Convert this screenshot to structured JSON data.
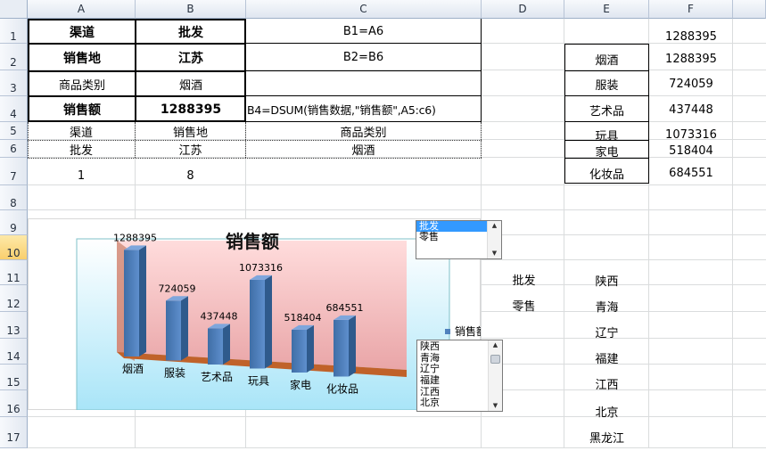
{
  "columns": [
    "A",
    "B",
    "C",
    "D",
    "E",
    "F"
  ],
  "rows": [
    "1",
    "2",
    "3",
    "4",
    "5",
    "6",
    "7",
    "8",
    "9",
    "10",
    "11",
    "12",
    "13",
    "14",
    "15",
    "16",
    "17"
  ],
  "selected_row": "10",
  "criteria": {
    "a1": "渠道",
    "b1": "批发",
    "c1": "B1=A6",
    "a2": "销售地",
    "b2": "江苏",
    "c2": "B2=B6",
    "a3": "商品类别",
    "b3": "烟酒",
    "a4": "销售额",
    "b4": "1288395",
    "c4": "B4=DSUM(销售数据,\"销售额\",A5:c6)",
    "a5": "渠道",
    "b5": "销售地",
    "c5": "商品类别",
    "a6": "批发",
    "b6": "江苏",
    "c6": "烟酒",
    "a7": "1",
    "b7": "8"
  },
  "f1": "1288395",
  "categories_table": [
    {
      "name": "烟酒",
      "value": "1288395"
    },
    {
      "name": "服装",
      "value": "724059"
    },
    {
      "name": "艺术品",
      "value": "437448"
    },
    {
      "name": "玩具",
      "value": "1073316"
    },
    {
      "name": "家电",
      "value": "518404"
    },
    {
      "name": "化妆品",
      "value": "684551"
    }
  ],
  "channels": [
    "批发",
    "零售"
  ],
  "regions_col_e": [
    "陕西",
    "青海",
    "辽宁",
    "福建",
    "江西",
    "北京",
    "黑龙江"
  ],
  "channel_listbox": {
    "items": [
      "批发",
      "零售"
    ],
    "selected": "批发"
  },
  "region_listbox": {
    "items": [
      "陕西",
      "青海",
      "辽宁",
      "福建",
      "江西",
      "北京"
    ]
  },
  "chart_data": {
    "type": "bar",
    "title": "销售额",
    "categories": [
      "烟酒",
      "服装",
      "艺术品",
      "玩具",
      "家电",
      "化妆品"
    ],
    "series": [
      {
        "name": "销售额",
        "values": [
          1288395,
          724059,
          437448,
          1073316,
          518404,
          684551
        ]
      }
    ],
    "legend": "right",
    "colors": {
      "bar": "#4f81bd",
      "back_wall": "#f4b4b4",
      "floor": "#c0622a",
      "background": "#bfeefa"
    }
  }
}
